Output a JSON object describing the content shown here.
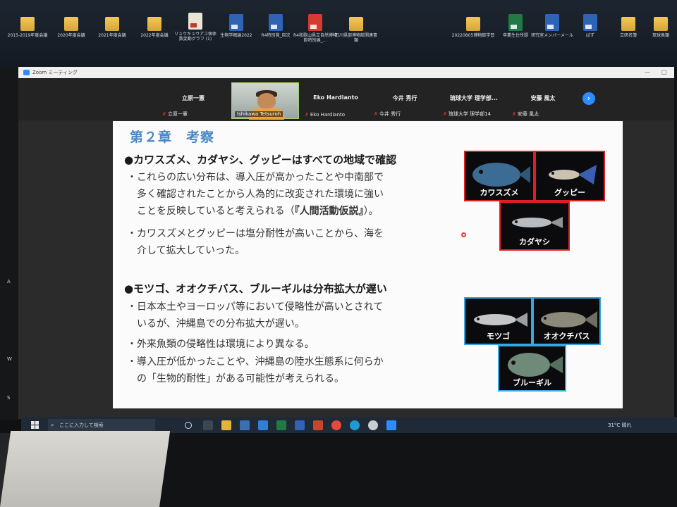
{
  "desktop_icons": [
    {
      "label": "2015-2019年度会議",
      "kind": "folder"
    },
    {
      "label": "2020年度会議",
      "kind": "folder"
    },
    {
      "label": "2021年度会議",
      "kind": "folder"
    },
    {
      "label": "2022年度会議",
      "kind": "folder"
    },
    {
      "label": "リュウキュウアユ個体数変動グラフ (1)",
      "kind": "doc"
    },
    {
      "label": "生物学概論2022",
      "kind": "word"
    },
    {
      "label": "R4特別賞_目次",
      "kind": "word"
    },
    {
      "label": "R4和歌山県立自然博物館特別展_...",
      "kind": "pdf"
    },
    {
      "label": "石川県部博物館関連書類",
      "kind": "folder"
    },
    {
      "label": "20220805博物館学習",
      "kind": "folder"
    },
    {
      "label": "卒業生住所録",
      "kind": "excel"
    },
    {
      "label": "研究室メンバーメール",
      "kind": "word"
    },
    {
      "label": "ばず",
      "kind": "word"
    },
    {
      "label": "立研名簿",
      "kind": "folder"
    },
    {
      "label": "琉球魚類",
      "kind": "folder"
    }
  ],
  "zoom": {
    "title": "Zoom ミーティング",
    "participants": [
      {
        "name": "立原一憲",
        "label": "立原一憲",
        "muted": true
      },
      {
        "name": "",
        "label": "Ishikawa Tetsuroh",
        "video": true
      },
      {
        "name": "Eko Hardianto",
        "label": "Eko Hardianto",
        "muted": true
      },
      {
        "name": "今井 秀行",
        "label": "今井 秀行",
        "muted": true
      },
      {
        "name": "琉球大学 理学部...",
        "label": "琉球大学 理学部14",
        "muted": true
      },
      {
        "name": "安藤 風太",
        "label": "安藤 風太",
        "muted": true
      }
    ],
    "next_icon": "chevron-right-icon",
    "mic_icon": "mic-muted-icon"
  },
  "slide": {
    "title": "第２章　考察",
    "section1": {
      "heading": "●カワスズメ、カダヤシ、グッピーはすべての地域で確認",
      "bullets": [
        {
          "l1": "これらの広い分布は、導入圧が高かったことや中南部で",
          "l2": "多く確認されたことから人為的に改変された環境に強い",
          "l3a": "ことを反映していると考えられる（",
          "l3b": "『人間活動仮説』",
          "l3c": "）。"
        },
        {
          "l1": "カワスズメとグッピーは塩分耐性が高いことから、海を",
          "l2": "介して拡大していった。"
        }
      ],
      "fish": [
        "カワスズメ",
        "グッピー",
        "カダヤシ"
      ]
    },
    "section2": {
      "heading": "●モツゴ、オオクチバス、ブルーギルは分布拡大が遅い",
      "bullets": [
        {
          "l1": "日本本土やヨーロッパ等において侵略性が高いとされて",
          "l2": "いるが、沖縄島での分布拡大が遅い。"
        },
        {
          "l1": "外来魚類の侵略性は環境により異なる。"
        },
        {
          "l1": "導入圧が低かったことや、沖縄島の陸水生態系に何らか",
          "l2": "の「生物的耐性」がある可能性が考えられる。"
        }
      ],
      "fish": [
        "モツゴ",
        "オオクチバス",
        "ブルーギル"
      ]
    },
    "bullet_marker": "・"
  },
  "taskbar": {
    "search_placeholder": "ここに入力して検索",
    "weather": "31°C 晴れ",
    "apps": [
      "task-view-icon",
      "file-explorer-icon",
      "store-icon",
      "mail-icon",
      "excel-icon",
      "word-icon",
      "powerpoint-icon",
      "chrome-icon",
      "edge-icon",
      "settings-icon",
      "zoom-icon"
    ]
  },
  "colors": {
    "title_blue": "#4a86c5",
    "frame_red": "#e02020",
    "frame_blue": "#36a7e0",
    "zoom_blue": "#2d8cff"
  }
}
